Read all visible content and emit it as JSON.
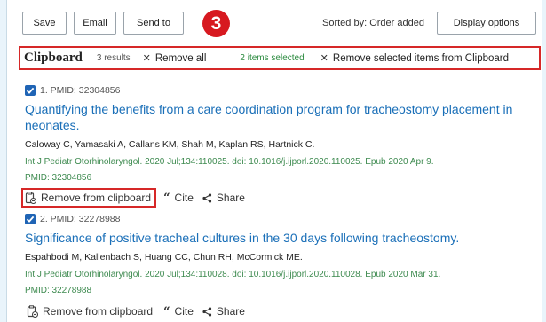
{
  "toolbar": {
    "save": "Save",
    "email": "Email",
    "send_to": "Send to",
    "step_number": "3",
    "sorted_by": "Sorted by: Order added",
    "display_options": "Display options"
  },
  "clipboard": {
    "title": "Clipboard",
    "results": "3 results",
    "remove_all": "Remove all",
    "selected": "2 items selected",
    "remove_selected": "Remove selected items from Clipboard"
  },
  "results": [
    {
      "checked": true,
      "label": "1. PMID: 32304856",
      "title_line1": "Quantifying the benefits from a care coordination program for tracheostomy placement in",
      "title_line2": "neonates.",
      "authors": "Caloway C, Yamasaki A, Callans KM, Shah M, Kaplan RS, Hartnick C.",
      "citation": "Int J Pediatr Otorhinolaryngol. 2020 Jul;134:110025. doi: 10.1016/j.ijporl.2020.110025. Epub 2020 Apr 9.",
      "pmid": "PMID: 32304856",
      "remove": "Remove from clipboard",
      "cite": "Cite",
      "share": "Share"
    },
    {
      "checked": true,
      "label": "2. PMID: 32278988",
      "title_line1": "Significance of positive tracheal cultures in the 30 days following tracheostomy.",
      "authors": "Espahbodi M, Kallenbach S, Huang CC, Chun RH, McCormick ME.",
      "citation": "Int J Pediatr Otorhinolaryngol. 2020 Jul;134:110028. doi: 10.1016/j.ijporl.2020.110028. Epub 2020 Mar 31.",
      "pmid": "PMID: 32278988",
      "remove": "Remove from clipboard",
      "cite": "Cite",
      "share": "Share"
    }
  ],
  "colors": {
    "link": "#1a6fb8",
    "citation_green": "#3d8a4f",
    "highlight_red": "#d62828",
    "checkbox_blue": "#1f64b5",
    "badge_red": "#d71920"
  }
}
